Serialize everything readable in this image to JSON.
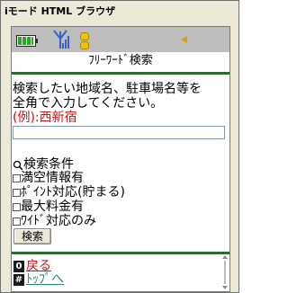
{
  "window": {
    "title": "iモード HTML ブラウザ"
  },
  "status": {
    "battery_icon": "battery-icon",
    "antenna_icon": "antenna-icon",
    "imode_icon": "imode-icon",
    "arrow_icon": "arrow-left-icon",
    "colors": {
      "battery": "#22aa22",
      "imode": "#f2c200",
      "arrow": "#e89c00",
      "divider": "#2f6b2f"
    }
  },
  "page": {
    "title": "ﾌﾘｰﾜｰﾄﾞ検索",
    "instruction_line1": "検索したい地域名、駐車場名等を",
    "instruction_line2": "全角で入力してください。",
    "example": "(例):西新宿",
    "search_value": ""
  },
  "conditions": {
    "heading": "検索条件",
    "options": [
      {
        "label": "満空情報有",
        "checked": false
      },
      {
        "label": "ﾎﾟｲﾝﾄ対応(貯まる)",
        "checked": false
      },
      {
        "label": "最大料金有",
        "checked": false
      },
      {
        "label": "ﾜｲﾄﾞ対応のみ",
        "checked": false
      }
    ],
    "submit_label": "検索"
  },
  "footer": {
    "back_key": "0",
    "back_label": "戻る",
    "top_key": "#",
    "top_label": "ﾄｯﾌﾟへ"
  }
}
